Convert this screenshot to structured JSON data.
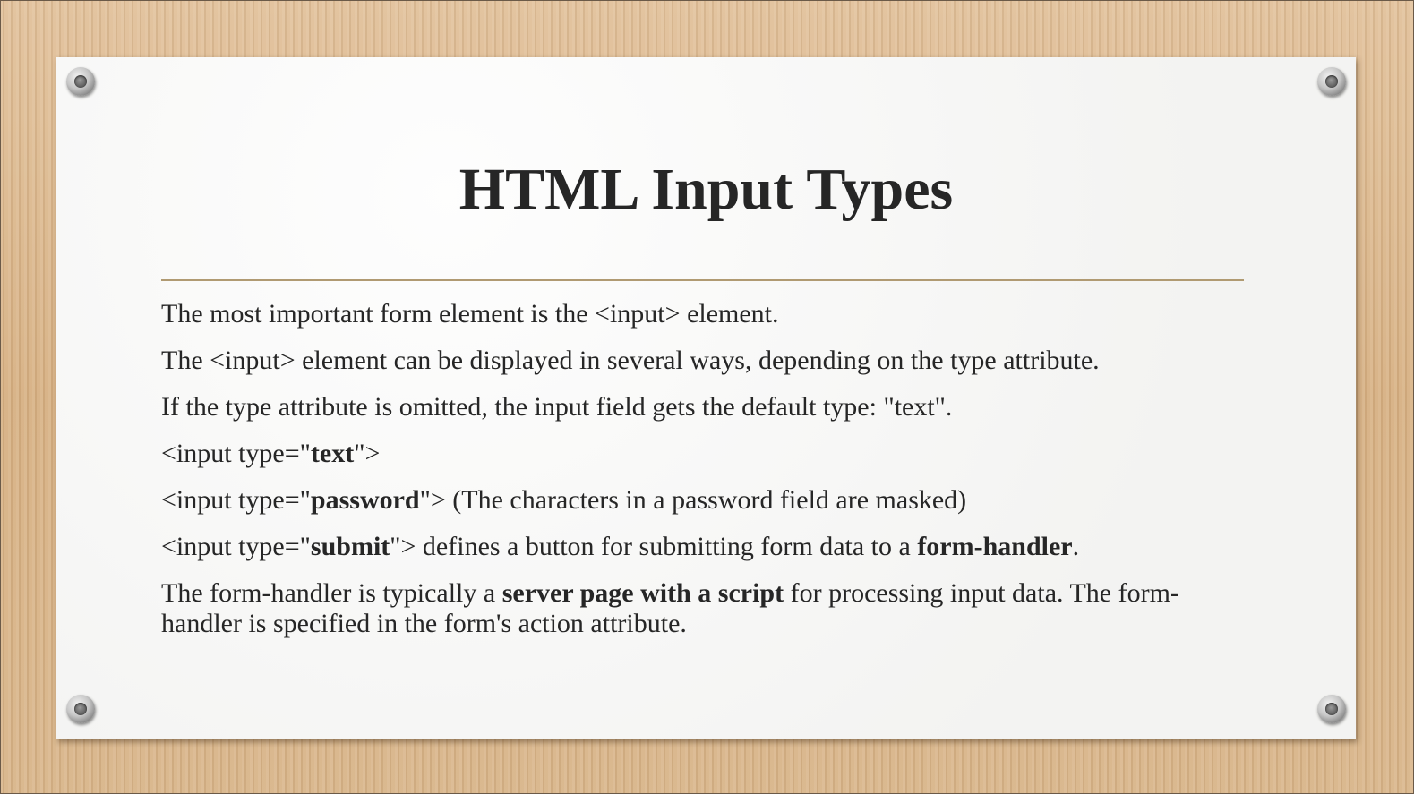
{
  "slide": {
    "title": "HTML Input Types",
    "paragraphs": {
      "p1": "The most important form element is the <input> element.",
      "p2": "The <input> element can be displayed in several ways, depending on the type attribute.",
      "p3": "If the type attribute is omitted, the input field gets the default type: \"text\".",
      "p4": {
        "prefix": "<input type=\"",
        "bold": "text",
        "suffix": "\">"
      },
      "p5": {
        "prefix": "<input type=\"",
        "bold": "password",
        "suffix": "\"> (The characters in a password field are masked)"
      },
      "p6": {
        "prefix": "<input type=\"",
        "bold": "submit",
        "middle": "\"> defines a button for submitting form data to a ",
        "bold2": "form-handler",
        "suffix": "."
      },
      "p7": {
        "prefix": "The form-handler is typically a ",
        "bold": "server page with a script",
        "suffix": " for processing input data. The form-handler is specified in the form's action attribute."
      }
    }
  },
  "colors": {
    "text": "#262626",
    "rule": "#b09a72",
    "paper": "#f8f8f7",
    "background": "#dcb88e"
  },
  "icons": [
    "pushpin-icon",
    "pushpin-icon",
    "pushpin-icon",
    "pushpin-icon"
  ]
}
